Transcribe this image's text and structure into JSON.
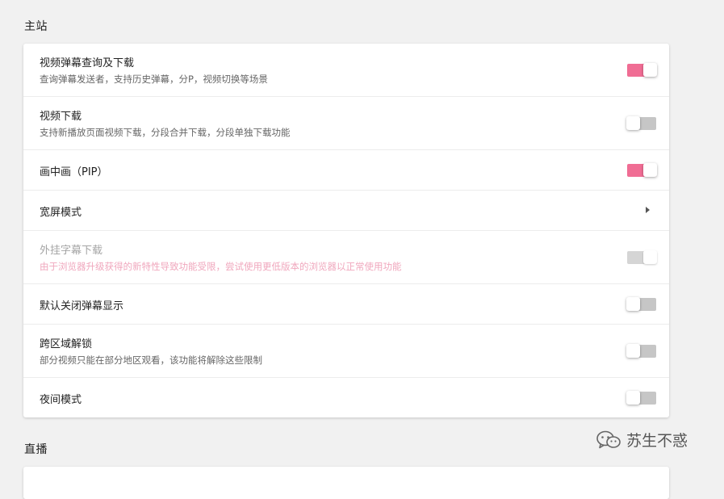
{
  "sections": {
    "main": "主站",
    "live": "直播"
  },
  "settings": [
    {
      "title": "视频弹幕查询及下载",
      "desc": "查询弹幕发送者，支持历史弹幕，分P，视频切换等场景",
      "control": "toggle",
      "state": "on"
    },
    {
      "title": "视频下载",
      "desc": "支持新播放页面视频下载，分段合并下载，分段单独下载功能",
      "control": "toggle",
      "state": "off"
    },
    {
      "title": "画中画（PIP）",
      "desc": "",
      "control": "toggle",
      "state": "on"
    },
    {
      "title": "宽屏模式",
      "desc": "",
      "control": "submenu",
      "state": "",
      "icon": "chevron-right-icon"
    },
    {
      "title": "外挂字幕下载",
      "desc": "由于浏览器升级获得的新特性导致功能受限，尝试使用更低版本的浏览器以正常使用功能",
      "control": "toggle",
      "state": "disabled"
    },
    {
      "title": "默认关闭弹幕显示",
      "desc": "",
      "control": "toggle",
      "state": "off"
    },
    {
      "title": "跨区域解锁",
      "desc": "部分视频只能在部分地区观看，该功能将解除这些限制",
      "control": "toggle",
      "state": "off"
    },
    {
      "title": "夜间模式",
      "desc": "",
      "control": "toggle",
      "state": "off"
    }
  ],
  "watermark": {
    "text": "苏生不惑",
    "icon": "wechat-icon"
  },
  "colors": {
    "accent": "#f06d94",
    "toggle_off": "#c6c6c6",
    "disabled_desc": "#f0a7bd",
    "background": "#f1f1f1"
  }
}
